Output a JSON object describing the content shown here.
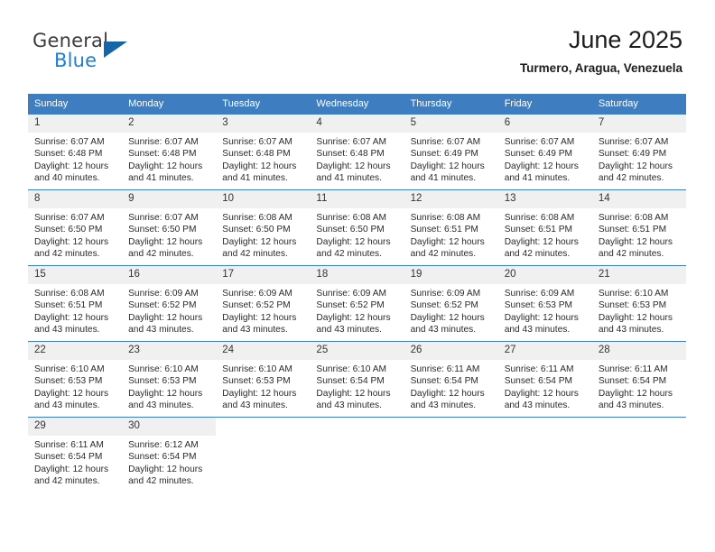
{
  "brand": {
    "name_part1": "General",
    "name_part2": "Blue",
    "triangle_color": "#1565a8",
    "blue_color": "#1a7fd4"
  },
  "header": {
    "title": "June 2025",
    "subtitle": "Turmero, Aragua, Venezuela"
  },
  "theme": {
    "header_blue": "#3e7dc0",
    "daynum_background": "#f0f0f0",
    "text_color": "#2a2a2a"
  },
  "weekday_headers": [
    "Sunday",
    "Monday",
    "Tuesday",
    "Wednesday",
    "Thursday",
    "Friday",
    "Saturday"
  ],
  "weeks": [
    [
      {
        "day": "1",
        "sunrise": "Sunrise: 6:07 AM",
        "sunset": "Sunset: 6:48 PM",
        "daylight_line1": "Daylight: 12 hours",
        "daylight_line2": "and 40 minutes."
      },
      {
        "day": "2",
        "sunrise": "Sunrise: 6:07 AM",
        "sunset": "Sunset: 6:48 PM",
        "daylight_line1": "Daylight: 12 hours",
        "daylight_line2": "and 41 minutes."
      },
      {
        "day": "3",
        "sunrise": "Sunrise: 6:07 AM",
        "sunset": "Sunset: 6:48 PM",
        "daylight_line1": "Daylight: 12 hours",
        "daylight_line2": "and 41 minutes."
      },
      {
        "day": "4",
        "sunrise": "Sunrise: 6:07 AM",
        "sunset": "Sunset: 6:48 PM",
        "daylight_line1": "Daylight: 12 hours",
        "daylight_line2": "and 41 minutes."
      },
      {
        "day": "5",
        "sunrise": "Sunrise: 6:07 AM",
        "sunset": "Sunset: 6:49 PM",
        "daylight_line1": "Daylight: 12 hours",
        "daylight_line2": "and 41 minutes."
      },
      {
        "day": "6",
        "sunrise": "Sunrise: 6:07 AM",
        "sunset": "Sunset: 6:49 PM",
        "daylight_line1": "Daylight: 12 hours",
        "daylight_line2": "and 41 minutes."
      },
      {
        "day": "7",
        "sunrise": "Sunrise: 6:07 AM",
        "sunset": "Sunset: 6:49 PM",
        "daylight_line1": "Daylight: 12 hours",
        "daylight_line2": "and 42 minutes."
      }
    ],
    [
      {
        "day": "8",
        "sunrise": "Sunrise: 6:07 AM",
        "sunset": "Sunset: 6:50 PM",
        "daylight_line1": "Daylight: 12 hours",
        "daylight_line2": "and 42 minutes."
      },
      {
        "day": "9",
        "sunrise": "Sunrise: 6:07 AM",
        "sunset": "Sunset: 6:50 PM",
        "daylight_line1": "Daylight: 12 hours",
        "daylight_line2": "and 42 minutes."
      },
      {
        "day": "10",
        "sunrise": "Sunrise: 6:08 AM",
        "sunset": "Sunset: 6:50 PM",
        "daylight_line1": "Daylight: 12 hours",
        "daylight_line2": "and 42 minutes."
      },
      {
        "day": "11",
        "sunrise": "Sunrise: 6:08 AM",
        "sunset": "Sunset: 6:50 PM",
        "daylight_line1": "Daylight: 12 hours",
        "daylight_line2": "and 42 minutes."
      },
      {
        "day": "12",
        "sunrise": "Sunrise: 6:08 AM",
        "sunset": "Sunset: 6:51 PM",
        "daylight_line1": "Daylight: 12 hours",
        "daylight_line2": "and 42 minutes."
      },
      {
        "day": "13",
        "sunrise": "Sunrise: 6:08 AM",
        "sunset": "Sunset: 6:51 PM",
        "daylight_line1": "Daylight: 12 hours",
        "daylight_line2": "and 42 minutes."
      },
      {
        "day": "14",
        "sunrise": "Sunrise: 6:08 AM",
        "sunset": "Sunset: 6:51 PM",
        "daylight_line1": "Daylight: 12 hours",
        "daylight_line2": "and 42 minutes."
      }
    ],
    [
      {
        "day": "15",
        "sunrise": "Sunrise: 6:08 AM",
        "sunset": "Sunset: 6:51 PM",
        "daylight_line1": "Daylight: 12 hours",
        "daylight_line2": "and 43 minutes."
      },
      {
        "day": "16",
        "sunrise": "Sunrise: 6:09 AM",
        "sunset": "Sunset: 6:52 PM",
        "daylight_line1": "Daylight: 12 hours",
        "daylight_line2": "and 43 minutes."
      },
      {
        "day": "17",
        "sunrise": "Sunrise: 6:09 AM",
        "sunset": "Sunset: 6:52 PM",
        "daylight_line1": "Daylight: 12 hours",
        "daylight_line2": "and 43 minutes."
      },
      {
        "day": "18",
        "sunrise": "Sunrise: 6:09 AM",
        "sunset": "Sunset: 6:52 PM",
        "daylight_line1": "Daylight: 12 hours",
        "daylight_line2": "and 43 minutes."
      },
      {
        "day": "19",
        "sunrise": "Sunrise: 6:09 AM",
        "sunset": "Sunset: 6:52 PM",
        "daylight_line1": "Daylight: 12 hours",
        "daylight_line2": "and 43 minutes."
      },
      {
        "day": "20",
        "sunrise": "Sunrise: 6:09 AM",
        "sunset": "Sunset: 6:53 PM",
        "daylight_line1": "Daylight: 12 hours",
        "daylight_line2": "and 43 minutes."
      },
      {
        "day": "21",
        "sunrise": "Sunrise: 6:10 AM",
        "sunset": "Sunset: 6:53 PM",
        "daylight_line1": "Daylight: 12 hours",
        "daylight_line2": "and 43 minutes."
      }
    ],
    [
      {
        "day": "22",
        "sunrise": "Sunrise: 6:10 AM",
        "sunset": "Sunset: 6:53 PM",
        "daylight_line1": "Daylight: 12 hours",
        "daylight_line2": "and 43 minutes."
      },
      {
        "day": "23",
        "sunrise": "Sunrise: 6:10 AM",
        "sunset": "Sunset: 6:53 PM",
        "daylight_line1": "Daylight: 12 hours",
        "daylight_line2": "and 43 minutes."
      },
      {
        "day": "24",
        "sunrise": "Sunrise: 6:10 AM",
        "sunset": "Sunset: 6:53 PM",
        "daylight_line1": "Daylight: 12 hours",
        "daylight_line2": "and 43 minutes."
      },
      {
        "day": "25",
        "sunrise": "Sunrise: 6:10 AM",
        "sunset": "Sunset: 6:54 PM",
        "daylight_line1": "Daylight: 12 hours",
        "daylight_line2": "and 43 minutes."
      },
      {
        "day": "26",
        "sunrise": "Sunrise: 6:11 AM",
        "sunset": "Sunset: 6:54 PM",
        "daylight_line1": "Daylight: 12 hours",
        "daylight_line2": "and 43 minutes."
      },
      {
        "day": "27",
        "sunrise": "Sunrise: 6:11 AM",
        "sunset": "Sunset: 6:54 PM",
        "daylight_line1": "Daylight: 12 hours",
        "daylight_line2": "and 43 minutes."
      },
      {
        "day": "28",
        "sunrise": "Sunrise: 6:11 AM",
        "sunset": "Sunset: 6:54 PM",
        "daylight_line1": "Daylight: 12 hours",
        "daylight_line2": "and 43 minutes."
      }
    ],
    [
      {
        "day": "29",
        "sunrise": "Sunrise: 6:11 AM",
        "sunset": "Sunset: 6:54 PM",
        "daylight_line1": "Daylight: 12 hours",
        "daylight_line2": "and 42 minutes."
      },
      {
        "day": "30",
        "sunrise": "Sunrise: 6:12 AM",
        "sunset": "Sunset: 6:54 PM",
        "daylight_line1": "Daylight: 12 hours",
        "daylight_line2": "and 42 minutes."
      },
      {
        "day": "",
        "sunrise": "",
        "sunset": "",
        "daylight_line1": "",
        "daylight_line2": ""
      },
      {
        "day": "",
        "sunrise": "",
        "sunset": "",
        "daylight_line1": "",
        "daylight_line2": ""
      },
      {
        "day": "",
        "sunrise": "",
        "sunset": "",
        "daylight_line1": "",
        "daylight_line2": ""
      },
      {
        "day": "",
        "sunrise": "",
        "sunset": "",
        "daylight_line1": "",
        "daylight_line2": ""
      },
      {
        "day": "",
        "sunrise": "",
        "sunset": "",
        "daylight_line1": "",
        "daylight_line2": ""
      }
    ]
  ]
}
